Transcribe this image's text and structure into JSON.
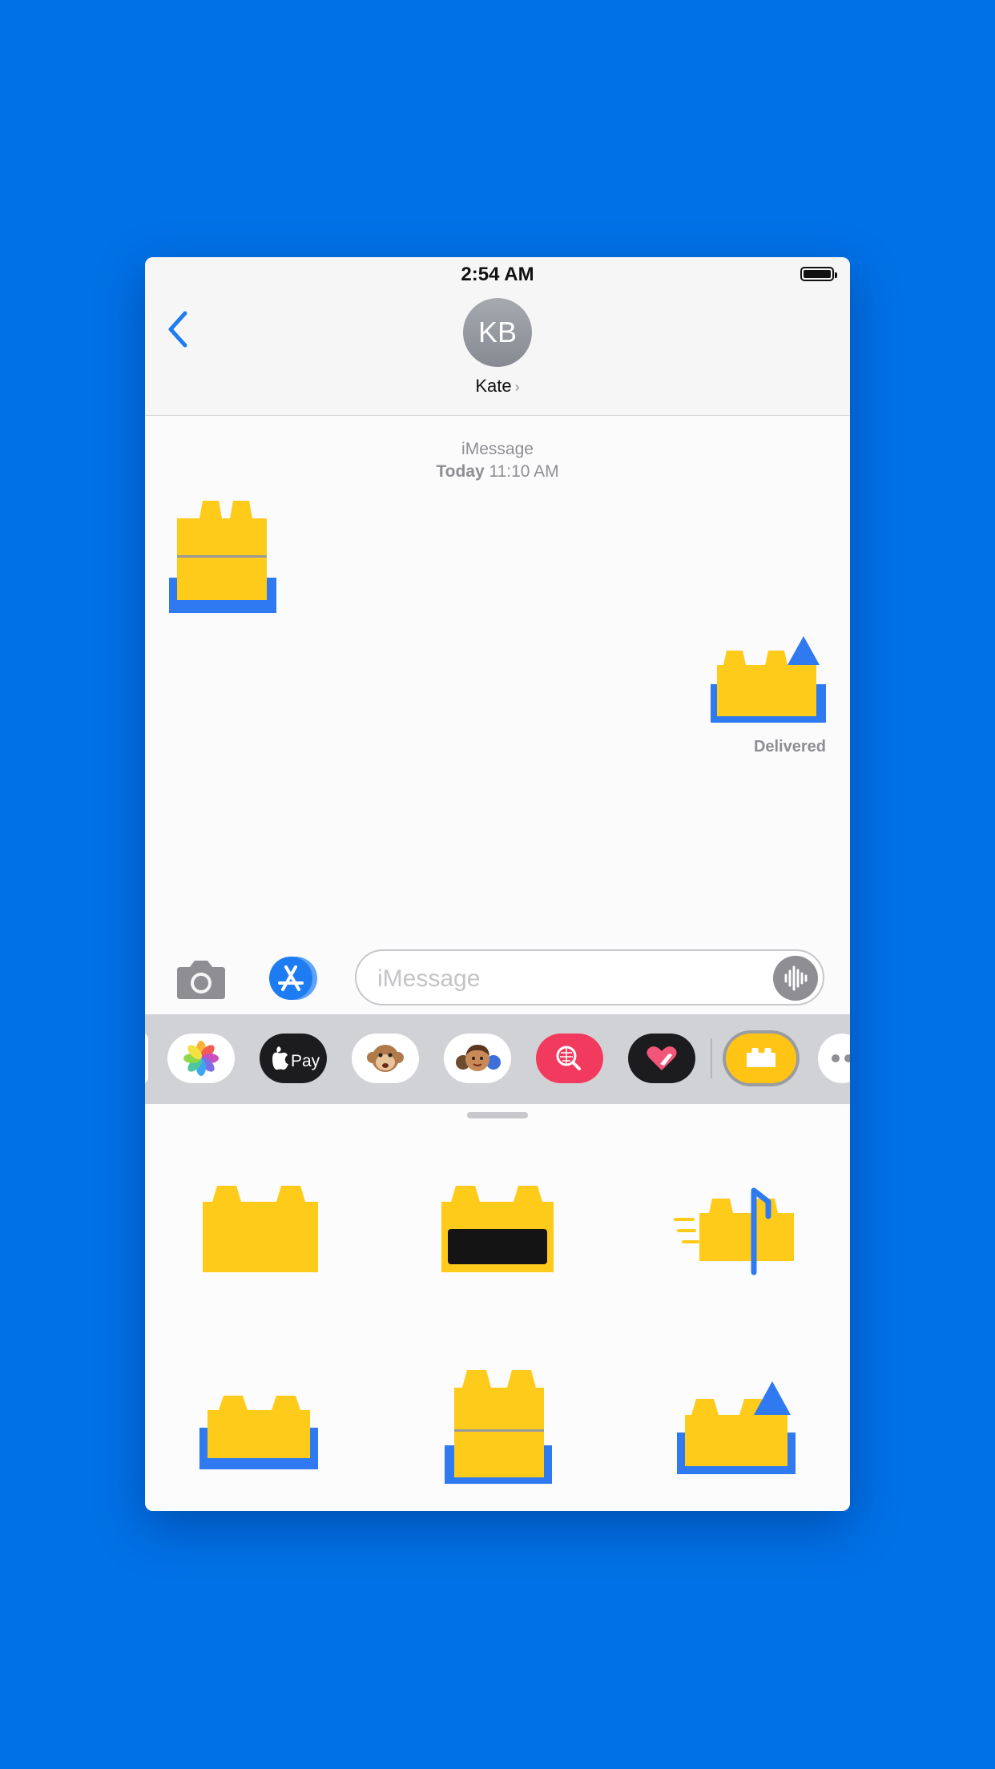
{
  "status": {
    "time": "2:54 AM"
  },
  "header": {
    "avatar_initials": "KB",
    "contact_name": "Kate"
  },
  "conversation": {
    "service": "iMessage",
    "day": "Today",
    "time": "11:10 AM",
    "delivered_label": "Delivered"
  },
  "input": {
    "placeholder": "iMessage"
  },
  "app_strip": {
    "items": [
      "photos-app",
      "apple-pay-app",
      "animoji-app",
      "memoji-app",
      "images-search-app",
      "digital-touch-app",
      "brick-sticker-app",
      "more-apps"
    ],
    "selected": "brick-sticker-app"
  },
  "colors": {
    "background": "#0071E6",
    "brick_yellow": "#FFCB1B",
    "brick_blue": "#2F7AF0",
    "accent_blue": "#1E7CF2"
  }
}
